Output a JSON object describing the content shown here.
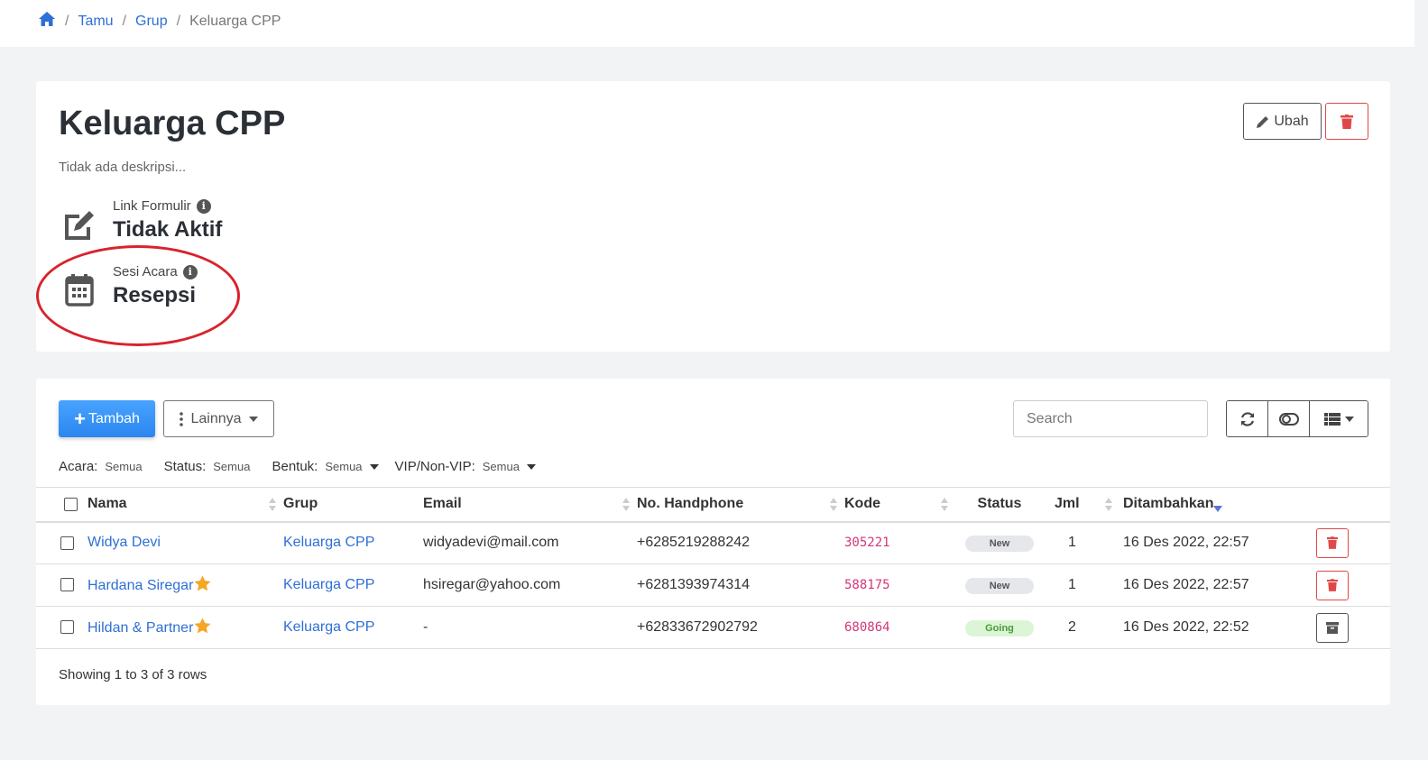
{
  "breadcrumb": {
    "home_icon": "home-icon",
    "items": [
      "Tamu",
      "Grup"
    ],
    "current": "Keluarga CPP"
  },
  "group": {
    "title": "Keluarga CPP",
    "description": "Tidak ada deskripsi...",
    "link_formulir": {
      "label": "Link Formulir",
      "value": "Tidak Aktif",
      "icon": "edit-icon"
    },
    "sesi_acara": {
      "label": "Sesi Acara",
      "value": "Resepsi",
      "icon": "calendar-icon"
    },
    "edit_button": "Ubah"
  },
  "toolbar": {
    "add_button": "Tambah",
    "more_button": "Lainnya",
    "search_placeholder": "Search"
  },
  "filters": [
    {
      "label": "Acara:",
      "value": "Semua",
      "dropdown": false
    },
    {
      "label": "Status:",
      "value": "Semua",
      "dropdown": false
    },
    {
      "label": "Bentuk:",
      "value": "Semua",
      "dropdown": true
    },
    {
      "label": "VIP/Non-VIP:",
      "value": "Semua",
      "dropdown": true
    }
  ],
  "table": {
    "headers": {
      "nama": "Nama",
      "grup": "Grup",
      "email": "Email",
      "phone": "No. Handphone",
      "kode": "Kode",
      "status": "Status",
      "jml": "Jml",
      "added": "Ditambahkan"
    },
    "rows": [
      {
        "nama": "Widya Devi",
        "vip": false,
        "grup": "Keluarga CPP",
        "email": "widyadevi@mail.com",
        "phone": "+6285219288242",
        "kode": "305221",
        "status": "New",
        "jml": "1",
        "added": "16 Des 2022, 22:57",
        "action": "delete"
      },
      {
        "nama": "Hardana Siregar",
        "vip": true,
        "grup": "Keluarga CPP",
        "email": "hsiregar@yahoo.com",
        "phone": "+6281393974314",
        "kode": "588175",
        "status": "New",
        "jml": "1",
        "added": "16 Des 2022, 22:57",
        "action": "delete"
      },
      {
        "nama": "Hildan & Partner",
        "vip": true,
        "grup": "Keluarga CPP",
        "email": "-",
        "phone": "+62833672902792",
        "kode": "680864",
        "status": "Going",
        "jml": "2",
        "added": "16 Des 2022, 22:52",
        "action": "archive"
      }
    ],
    "footer": "Showing 1 to 3 of 3 rows"
  },
  "colors": {
    "link": "#2f6fd6",
    "danger": "#e04848",
    "primary": "#2b86f0",
    "annotation": "#d9232c"
  }
}
